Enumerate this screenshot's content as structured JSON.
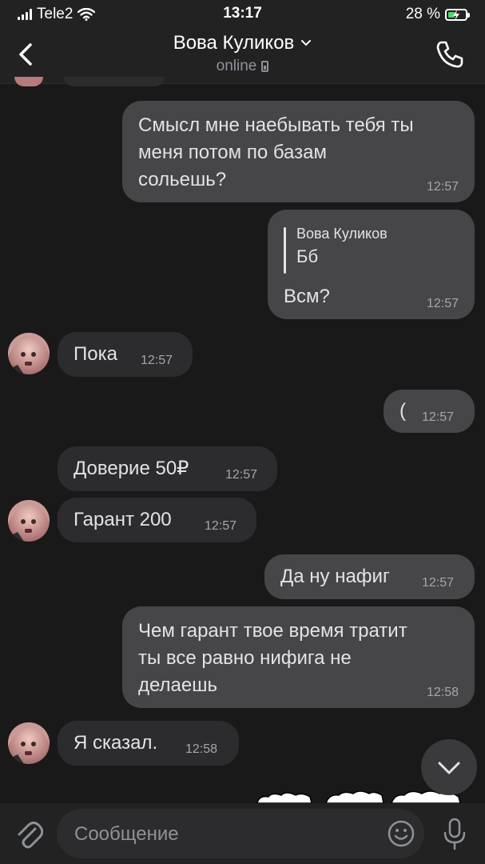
{
  "status_bar": {
    "carrier": "Tele2",
    "time": "13:17",
    "battery": "28 %"
  },
  "header": {
    "name": "Вова Куликов",
    "status": "online"
  },
  "messages": [
    {
      "dir": "out",
      "text": "Смысл мне наебывать тебя ты\nменя потом по базам\nсольешь?",
      "time": "12:57"
    },
    {
      "dir": "out",
      "reply_author": "Вова Куликов",
      "reply_text": "Бб",
      "text": "Всм?",
      "time": "12:57"
    },
    {
      "dir": "in",
      "text": "Пока",
      "time": "12:57"
    },
    {
      "dir": "out",
      "text": "(",
      "time": "12:57"
    },
    {
      "dir": "in",
      "text": "Доверие 50₽",
      "time": "12:57"
    },
    {
      "dir": "in",
      "text": "Гарант 200",
      "time": "12:57"
    },
    {
      "dir": "out",
      "text": "Да ну нафиг",
      "time": "12:57"
    },
    {
      "dir": "out",
      "text": "Чем гарант твое время тратит\nты все равно нифига не\nделаешь",
      "time": "12:58"
    },
    {
      "dir": "in",
      "text": "Я сказал.",
      "time": "12:58"
    }
  ],
  "input": {
    "placeholder": "Сообщение"
  },
  "colors": {
    "background": "#19191a",
    "bubble_out": "#464649",
    "bubble_in": "#2c2c2e",
    "bar": "#222223"
  }
}
